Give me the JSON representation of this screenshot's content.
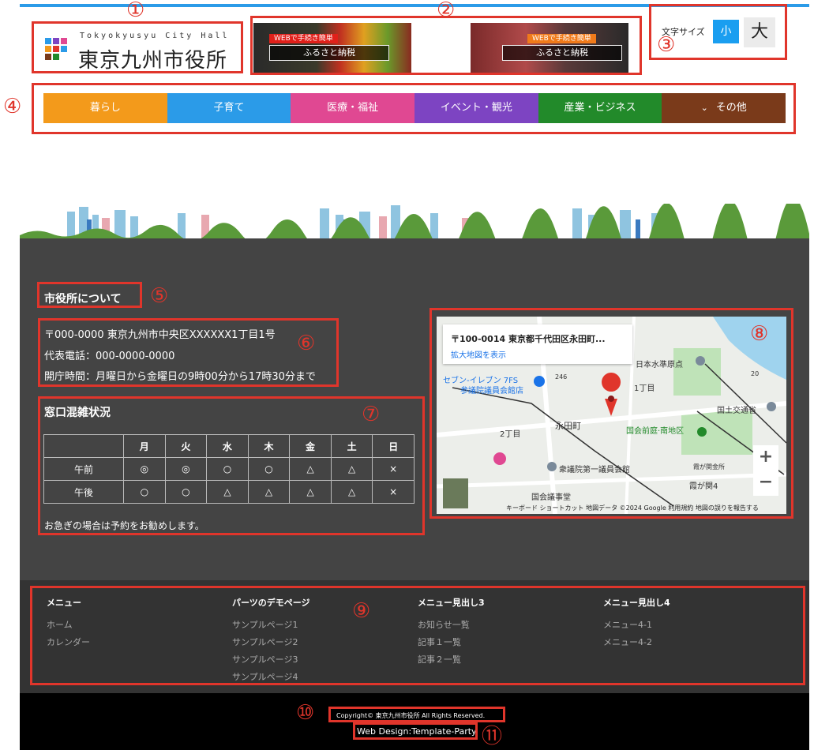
{
  "header": {
    "logo_sub": "Tokyokyusyu City Hall",
    "logo_main": "東京九州市役所",
    "banners": [
      {
        "tag": "WEBで手続き簡単",
        "label": "ふるさと納税"
      },
      {
        "tag": "WEBで手続き簡単",
        "label": "ふるさと納税"
      }
    ],
    "font_size": {
      "label": "文字サイズ",
      "small": "小",
      "large": "大"
    }
  },
  "nav": {
    "items": [
      {
        "label": "暮らし",
        "color": "#f39a1b"
      },
      {
        "label": "子育て",
        "color": "#2b9be8"
      },
      {
        "label": "医療・福祉",
        "color": "#e04892"
      },
      {
        "label": "イベント・観光",
        "color": "#7d44c2"
      },
      {
        "label": "産業・ビジネス",
        "color": "#228a2a"
      },
      {
        "label": "その他",
        "color": "#7a3a1a",
        "icon": "chevron-down-icon"
      }
    ]
  },
  "about": {
    "title": "市役所について",
    "address": "〒000-0000 東京九州市中央区XXXXXX1丁目1号",
    "phone": "代表電話：000-0000-0000",
    "hours": "開庁時間：月曜日から金曜日の9時00分から17時30分まで"
  },
  "congestion": {
    "title": "窓口混雑状況",
    "days": [
      "月",
      "火",
      "水",
      "木",
      "金",
      "土",
      "日"
    ],
    "rows": [
      {
        "label": "午前",
        "values": [
          "◎",
          "◎",
          "○",
          "○",
          "△",
          "△",
          "×"
        ]
      },
      {
        "label": "午後",
        "values": [
          "○",
          "○",
          "△",
          "△",
          "△",
          "△",
          "×"
        ]
      }
    ],
    "note": "お急ぎの場合は予約をお勧めします。"
  },
  "map": {
    "address": "〒100-0014 東京都千代田区永田町...",
    "link": "拡大地図を表示",
    "labels": [
      "日本水準原点",
      "1丁目",
      "セブン-イレブン 7FS",
      "参議院議員会館店",
      "国土交通省",
      "永田町",
      "2丁目",
      "国会前庭·南地区",
      "衆議院第一議員会館",
      "霞が関4",
      "霞が関金所",
      "国会議事堂",
      "246",
      "20"
    ],
    "footer": "キーボード ショートカット   地図データ ©2024 Google   利用規約   地図の誤りを報告する",
    "zoom_in": "+",
    "zoom_out": "−"
  },
  "footer_menu": {
    "columns": [
      {
        "heading": "メニュー",
        "links": [
          "ホーム",
          "カレンダー"
        ]
      },
      {
        "heading": "パーツのデモページ",
        "links": [
          "サンプルページ1",
          "サンプルページ2",
          "サンプルページ3",
          "サンプルページ4"
        ]
      },
      {
        "heading": "メニュー見出し3",
        "links": [
          "お知らせ一覧",
          "記事１一覧",
          "記事２一覧"
        ]
      },
      {
        "heading": "メニュー見出し4",
        "links": [
          "メニュー4-1",
          "メニュー4-2"
        ]
      }
    ]
  },
  "footer": {
    "copyright": "Copyright© 東京九州市役所 All Rights Reserved.",
    "webdesign": "Web Design:Template-Party"
  },
  "annotations": [
    "①",
    "②",
    "③",
    "④",
    "⑤",
    "⑥",
    "⑦",
    "⑧",
    "⑨",
    "⑩",
    "⑪"
  ]
}
